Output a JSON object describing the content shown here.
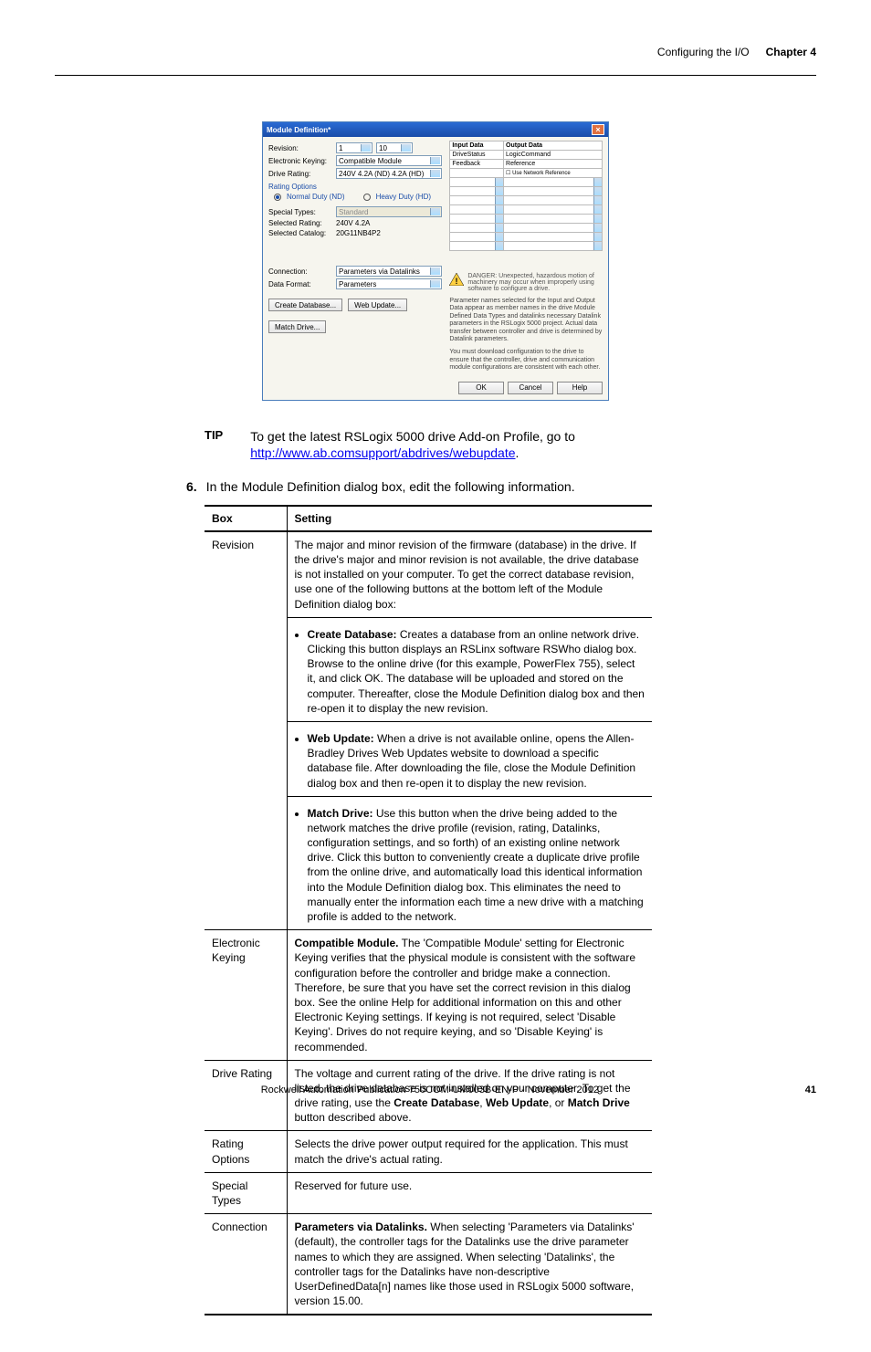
{
  "header": {
    "section_title": "Configuring the I/O",
    "chapter_label": "Chapter 4"
  },
  "dialog": {
    "title": "Module Definition*",
    "fields": {
      "revision_label": "Revision:",
      "revision_major": "1",
      "revision_minor": "10",
      "ek_label": "Electronic Keying:",
      "ek_value": "Compatible Module",
      "dr_label": "Drive Rating:",
      "dr_value": "240V  4.2A (ND)  4.2A (HD)",
      "ropts_label": "Rating Options",
      "ropt1": "Normal Duty (ND)",
      "ropt2": "Heavy Duty (HD)",
      "st_label": "Special Types:",
      "st_value": "Standard",
      "sr_label": "Selected Rating:",
      "sr_value": "240V   4.2A",
      "sc_label": "Selected Catalog:",
      "sc_value": "20G11NB4P2",
      "conn_label": "Connection:",
      "conn_value": "Parameters via Datalinks",
      "df_label": "Data Format:",
      "df_value": "Parameters"
    },
    "io_table": {
      "h1": "Input Data",
      "h2": "Output Data",
      "r1a": "DriveStatus",
      "r1b": "LogicCommand",
      "r2a": "Feedback",
      "r2b": "Reference",
      "chk": "Use Network Reference"
    },
    "danger": "DANGER: Unexpected, hazardous motion of machinery may occur when improperly using software to configure a drive.",
    "para1": "Parameter names selected for the Input and Output Data appear as member names in the drive Module Defined Data Types and datalinks necessary Datalink parameters in the RSLogix 5000 project. Actual data transfer between controller and drive is determined by Datalink parameters.",
    "para2": "You must download configuration to the drive to ensure that the controller, drive and communication module configurations are consistent with each other.",
    "buttons": {
      "create_db": "Create Database...",
      "web_update": "Web Update...",
      "match_drive": "Match Drive...",
      "ok": "OK",
      "cancel": "Cancel",
      "help": "Help"
    }
  },
  "tip": {
    "label": "TIP",
    "text_before": "To get the latest RSLogix 5000 drive Add-on Profile, go to ",
    "link": "http://www.ab.comsupport/abdrives/webupdate",
    "text_after": "."
  },
  "step": {
    "num": "6.",
    "text": "In the Module Definition dialog box, edit the following information."
  },
  "table": {
    "h_box": "Box",
    "h_setting": "Setting",
    "rows": [
      {
        "box": "Revision",
        "setting_intro": "The major and minor revision of the firmware (database) in the drive. If the drive's major and minor revision is not available, the drive database is not installed on your computer. To get the correct database revision, use one of the following buttons at the bottom left of the Module Definition dialog box:",
        "bullets": [
          {
            "strong": "Create Database:",
            "text": " Creates a database from an online network drive. Clicking this button displays an RSLinx software RSWho dialog box. Browse to the online drive (for this example, PowerFlex 755), select it, and click OK. The database will be uploaded and stored on the computer. Thereafter, close the Module Definition dialog box and then re-open it to display the new revision."
          },
          {
            "strong": "Web Update:",
            "text": " When a drive is not available online, opens the Allen-Bradley Drives Web Updates website to download a specific database file. After downloading the file, close the Module Definition dialog box and then re-open it to display the new revision."
          },
          {
            "strong": "Match Drive:",
            "text": " Use this button when the drive being added to the network matches the drive profile (revision, rating, Datalinks, configuration settings, and so forth) of an existing online network drive. Click this button to conveniently create a duplicate drive profile from the online drive, and automatically load this identical information into the Module Definition dialog box. This eliminates the need to manually enter the information each time a new drive with a matching profile is added to the network."
          }
        ]
      },
      {
        "box": "Electronic Keying",
        "setting_plain_pre_strong": "Compatible Module.",
        "setting_plain": " The 'Compatible Module' setting for Electronic Keying verifies that the physical module is consistent with the software configuration before the controller and bridge make a connection. Therefore, be sure that you have set the correct revision in this dialog box. See the online Help for additional information on this and other Electronic Keying settings. If keying is not required, select 'Disable Keying'. Drives do not require keying, and so 'Disable Keying' is recommended."
      },
      {
        "box": "Drive Rating",
        "setting_plain_pre": "The voltage and current rating of the drive. If the drive rating is not listed, the drive database is not installed on your computer. To get the drive rating, use the ",
        "setting_plain_strong2": "Create Database",
        "setting_plain_mid": ", ",
        "setting_plain_strong3": "Web Update",
        "setting_plain_mid2": ", or ",
        "setting_plain_strong4": "Match Drive",
        "setting_plain_post": " button described above."
      },
      {
        "box": "Rating Options",
        "setting_plain": "Selects the drive power output required for the application. This must match the drive's actual rating."
      },
      {
        "box": "Special Types",
        "setting_plain": "Reserved for future use."
      },
      {
        "box": "Connection",
        "setting_plain_pre_strong": "Parameters via Datalinks.",
        "setting_plain": " When selecting 'Parameters via Datalinks' (default), the controller tags for the Datalinks use the drive parameter names to which they are assigned. When selecting 'Datalinks', the controller tags for the Datalinks have non-descriptive UserDefinedData[n] names like those used in RSLogix 5000 software, version 15.00."
      }
    ]
  },
  "footer": {
    "pub": "Rockwell Automation Publication 750COM-UM003B-EN-P - November 2012",
    "page": "41"
  }
}
